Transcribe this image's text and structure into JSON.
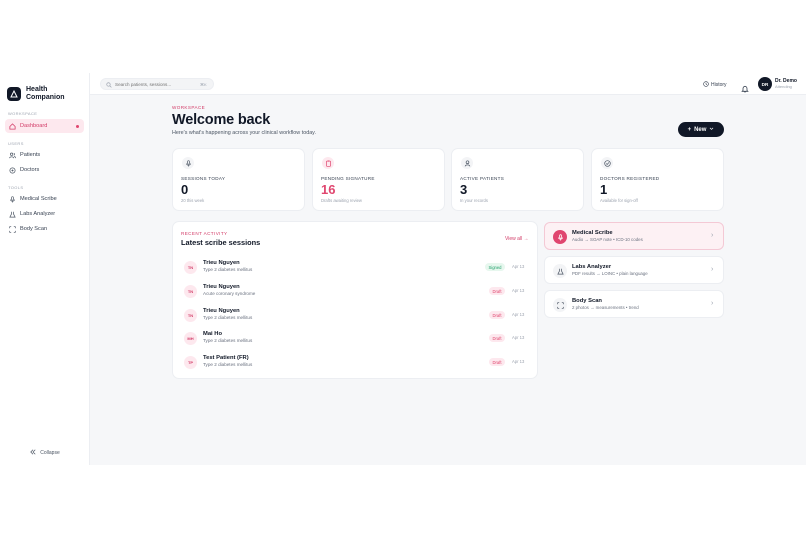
{
  "brand": {
    "name_line1": "Health",
    "name_line2": "Companion"
  },
  "sidebar": {
    "sections": [
      {
        "label": "WORKSPACE",
        "items": [
          {
            "label": "Dashboard",
            "icon": "home-icon",
            "active": true
          }
        ]
      },
      {
        "label": "USERS",
        "items": [
          {
            "label": "Patients",
            "icon": "users-icon"
          },
          {
            "label": "Doctors",
            "icon": "stethoscope-icon"
          }
        ]
      },
      {
        "label": "TOOLS",
        "items": [
          {
            "label": "Medical Scribe",
            "icon": "mic-icon"
          },
          {
            "label": "Labs Analyzer",
            "icon": "flask-icon"
          },
          {
            "label": "Body Scan",
            "icon": "scan-icon"
          }
        ]
      }
    ],
    "collapse_label": "Collapse"
  },
  "topbar": {
    "search_placeholder": "Search patients, sessions...",
    "search_shortcut": "⌘K",
    "history_label": "History",
    "user": {
      "initials": "DR",
      "name": "Dr. Demo",
      "role": "Attending"
    }
  },
  "header": {
    "eyebrow": "WORKSPACE",
    "title": "Welcome back",
    "subtitle": "Here's what's happening across your clinical workflow today.",
    "new_button": "New"
  },
  "stats": [
    {
      "label": "SESSIONS TODAY",
      "value": "0",
      "note": "20 this week",
      "icon": "mic-icon"
    },
    {
      "label": "PENDING SIGNATURE",
      "value": "16",
      "note": "Drafts awaiting review",
      "icon": "clipboard-icon",
      "accent": "#e0466f"
    },
    {
      "label": "ACTIVE PATIENTS",
      "value": "3",
      "note": "In your records",
      "icon": "user-icon"
    },
    {
      "label": "DOCTORS REGISTERED",
      "value": "1",
      "note": "Available for sign-off",
      "icon": "check-circle-icon"
    }
  ],
  "activity": {
    "eyebrow": "RECENT ACTIVITY",
    "title": "Latest scribe sessions",
    "view_all": "View all →",
    "sessions": [
      {
        "initials": "TN",
        "name": "Trieu Nguyen",
        "diagnosis": "Type 2 diabetes mellitus",
        "status": "Signed",
        "date": "Apr 13"
      },
      {
        "initials": "TN",
        "name": "Trieu Nguyen",
        "diagnosis": "Acute coronary syndrome",
        "status": "Draft",
        "date": "Apr 13"
      },
      {
        "initials": "TN",
        "name": "Trieu Nguyen",
        "diagnosis": "Type 2 diabetes mellitus",
        "status": "Draft",
        "date": "Apr 13"
      },
      {
        "initials": "MH",
        "name": "Mai Ho",
        "diagnosis": "Type 2 diabetes mellitus",
        "status": "Draft",
        "date": "Apr 13"
      },
      {
        "initials": "TP",
        "name": "Test Patient (FR)",
        "diagnosis": "Type 2 diabetes mellitus",
        "status": "Draft",
        "date": "Apr 13"
      }
    ]
  },
  "tools": [
    {
      "name": "Medical Scribe",
      "desc": "Audio → SOAP note • ICD-10 codes",
      "icon": "mic-icon",
      "active": true
    },
    {
      "name": "Labs Analyzer",
      "desc": "PDF results → LOINC • plain language",
      "icon": "flask-icon"
    },
    {
      "name": "Body Scan",
      "desc": "2 photos → measurements • trend",
      "icon": "scan-icon"
    }
  ],
  "colors": {
    "accent": "#e0466f",
    "accent_soft": "#fde8ee",
    "dark": "#111827",
    "signed": "#22a06b"
  }
}
